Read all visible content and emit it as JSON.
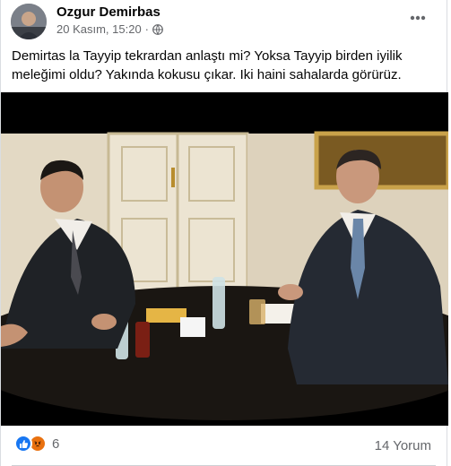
{
  "post": {
    "author": "Ozgur Demirbas",
    "date": "20 Kasım, 15:20",
    "separator": "·",
    "privacy_icon": "globe-icon",
    "more_icon": "more-dots-icon",
    "text": "Demirtas la Tayyip tekrardan anlaştı mi? Yoksa Tayyip birden iyilik meleğimi oldu? Yakında kokusu çıkar. Iki haini sahalarda görürüz.",
    "photo_icon": "meeting-photo"
  },
  "footer": {
    "reactions": [
      "like-icon",
      "angry-icon"
    ],
    "reaction_count": "6",
    "comments": "14 Yorum"
  },
  "colors": {
    "like": "#1877f2",
    "angry": "#e9710f",
    "secondary_text": "#65676b"
  }
}
